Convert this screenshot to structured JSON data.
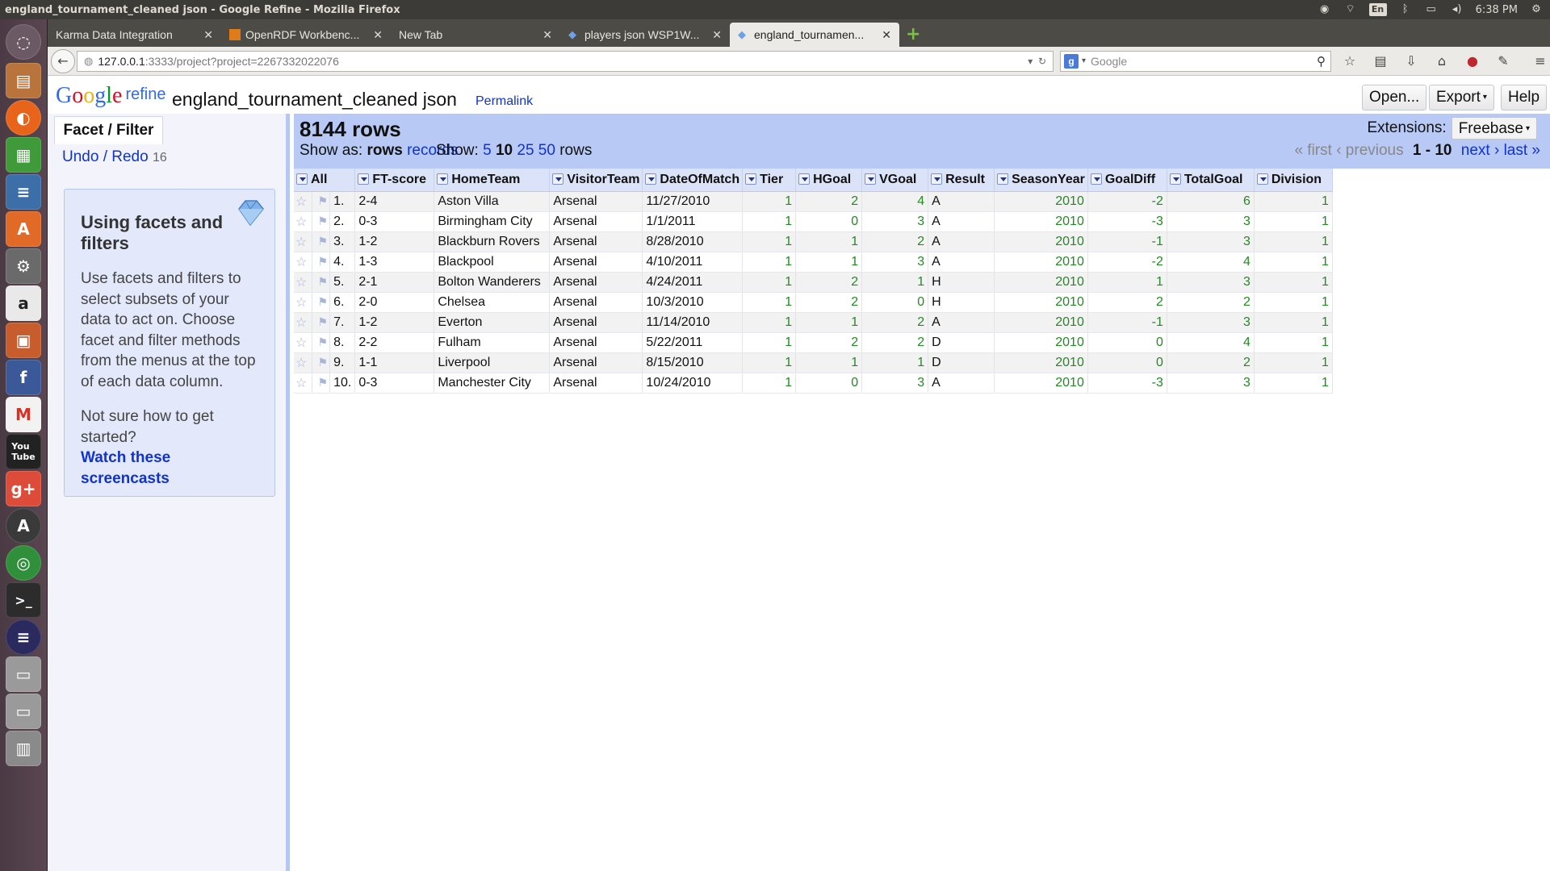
{
  "window": {
    "title": "england_tournament_cleaned json - Google Refine - Mozilla Firefox"
  },
  "tray": {
    "keyboard": "En",
    "time": "6:38 PM"
  },
  "tabs": [
    {
      "label": "Karma Data Integration",
      "active": false
    },
    {
      "label": "OpenRDF Workbenc...",
      "active": false
    },
    {
      "label": "New Tab",
      "active": false
    },
    {
      "label": "players json WSP1W...",
      "active": false
    },
    {
      "label": "england_tournamen...",
      "active": true
    }
  ],
  "nav": {
    "url_host": "127.0.0.1",
    "url_rest": ":3333/project?project=2267332022076",
    "search_placeholder": "Google"
  },
  "refine": {
    "logo_word": "refine",
    "project_name": "england_tournament_cleaned json",
    "permalink": "Permalink",
    "open_button": "Open...",
    "export_button": "Export",
    "help_button": "Help"
  },
  "left": {
    "facet_tab": "Facet / Filter",
    "undo_redo": "Undo / Redo",
    "undo_count": "16",
    "help_title": "Using facets and filters",
    "help_body": "Use facets and filters to select subsets of your data to act on. Choose facet and filter methods from the menus at the top of each data column.",
    "help_question": "Not sure how to get started?",
    "help_link": "Watch these screencasts"
  },
  "data_header": {
    "row_count": "8144 rows",
    "extensions_label": "Extensions:",
    "freebase": "Freebase",
    "show_as_label": "Show as:",
    "show_as_rows": "rows",
    "show_as_records": "records",
    "show_label": "Show:",
    "show_options": [
      "5",
      "10",
      "25",
      "50"
    ],
    "show_rows_word": "rows",
    "pager_first": "« first",
    "pager_previous": "‹ previous",
    "pager_range": "1 - 10",
    "pager_next": "next ›",
    "pager_last": "last »"
  },
  "table": {
    "columns": [
      "All",
      "FT-score",
      "HomeTeam",
      "VisitorTeam",
      "DateOfMatch",
      "Tier",
      "HGoal",
      "VGoal",
      "Result",
      "SeasonYear",
      "GoalDiff",
      "TotalGoal",
      "Division"
    ],
    "rows": [
      [
        "1.",
        "2-4",
        "Aston Villa",
        "Arsenal",
        "11/27/2010",
        "1",
        "2",
        "4",
        "A",
        "2010",
        "-2",
        "6",
        "1"
      ],
      [
        "2.",
        "0-3",
        "Birmingham City",
        "Arsenal",
        "1/1/2011",
        "1",
        "0",
        "3",
        "A",
        "2010",
        "-3",
        "3",
        "1"
      ],
      [
        "3.",
        "1-2",
        "Blackburn Rovers",
        "Arsenal",
        "8/28/2010",
        "1",
        "1",
        "2",
        "A",
        "2010",
        "-1",
        "3",
        "1"
      ],
      [
        "4.",
        "1-3",
        "Blackpool",
        "Arsenal",
        "4/10/2011",
        "1",
        "1",
        "3",
        "A",
        "2010",
        "-2",
        "4",
        "1"
      ],
      [
        "5.",
        "2-1",
        "Bolton Wanderers",
        "Arsenal",
        "4/24/2011",
        "1",
        "2",
        "1",
        "H",
        "2010",
        "1",
        "3",
        "1"
      ],
      [
        "6.",
        "2-0",
        "Chelsea",
        "Arsenal",
        "10/3/2010",
        "1",
        "2",
        "0",
        "H",
        "2010",
        "2",
        "2",
        "1"
      ],
      [
        "7.",
        "1-2",
        "Everton",
        "Arsenal",
        "11/14/2010",
        "1",
        "1",
        "2",
        "A",
        "2010",
        "-1",
        "3",
        "1"
      ],
      [
        "8.",
        "2-2",
        "Fulham",
        "Arsenal",
        "5/22/2011",
        "1",
        "2",
        "2",
        "D",
        "2010",
        "0",
        "4",
        "1"
      ],
      [
        "9.",
        "1-1",
        "Liverpool",
        "Arsenal",
        "8/15/2010",
        "1",
        "1",
        "1",
        "D",
        "2010",
        "0",
        "2",
        "1"
      ],
      [
        "10.",
        "0-3",
        "Manchester City",
        "Arsenal",
        "10/24/2010",
        "1",
        "0",
        "3",
        "A",
        "2010",
        "-3",
        "3",
        "1"
      ]
    ]
  }
}
